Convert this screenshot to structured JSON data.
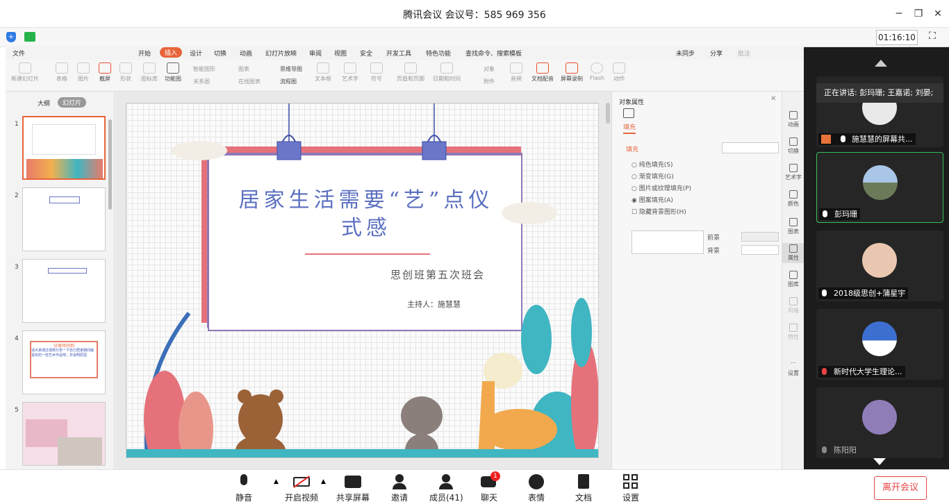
{
  "window": {
    "title": "腾讯会议 会议号：585 969 356"
  },
  "info": {
    "timer": "01:16:10"
  },
  "wps": {
    "menu": [
      "文件",
      "开始",
      "插入",
      "设计",
      "切换",
      "动画",
      "幻灯片放映",
      "审阅",
      "视图",
      "安全",
      "开发工具",
      "特色功能",
      "查找命令、搜索模板"
    ],
    "menu_right": [
      "未同步",
      "分享",
      "批注"
    ],
    "ribbon": [
      "新建幻灯片",
      "表格",
      "图片",
      "截屏",
      "形状",
      "图标库",
      "功能图",
      "智能图形",
      "关系图",
      "图表",
      "在线图表",
      "思维导图",
      "流程图",
      "文本框",
      "艺术字",
      "符号",
      "页眉和页脚",
      "日期和时间",
      "对象",
      "附件",
      "音频",
      "文档配音",
      "屏幕录制",
      "Flash",
      "动作"
    ],
    "tabs": {
      "outline": "大纲",
      "slides": "幻灯片"
    },
    "slide_numbers": [
      "1",
      "2",
      "3",
      "4",
      "5"
    ],
    "slide": {
      "title_line1": "居家生活需要“艺”点仪",
      "title_line2": "式感",
      "subtitle": "思创班第五次班会",
      "host": "主持人：施慧慧"
    },
    "thumb4": {
      "title": "分享时间到",
      "body": "请大家通过视频分享一下自己居家期间最喜欢的一些艺术作品吧，并说明原因"
    },
    "props": {
      "header": "对象属性",
      "tab": "填充",
      "section": "填充",
      "options": [
        "纯色填充(S)",
        "渐变填充(G)",
        "图片或纹理填充(P)",
        "图案填充(A)"
      ],
      "hide_bg": "隐藏背景图形(H)",
      "fg": "前景",
      "bg": "背景"
    },
    "sidetools": [
      "动画",
      "切换",
      "艺术字",
      "颜色",
      "图表",
      "属性",
      "图库",
      "风格",
      "特性",
      "设置"
    ]
  },
  "meeting": {
    "speaking": "正在讲话: 彭玛珊; 王嘉诺; 刘晏;",
    "tiles": [
      {
        "name": "施慧慧的屏幕共..."
      },
      {
        "name": "彭玛珊"
      },
      {
        "name": "2018级思创+蒲星宇"
      },
      {
        "name": "新时代大学生理论..."
      },
      {
        "name": "陈阳阳"
      }
    ]
  },
  "toolbar": {
    "mute": "静音",
    "video": "开启视频",
    "share": "共享屏幕",
    "invite": "邀请",
    "members": "成员(41)",
    "chat": "聊天",
    "chat_badge": "1",
    "reactions": "表情",
    "docs": "文档",
    "settings": "设置",
    "leave": "离开会议"
  },
  "colors": {
    "accent": "#e8643b",
    "speak_green": "#35c05a",
    "leave_red": "#e64545",
    "slide_title": "#5a6fc0"
  }
}
